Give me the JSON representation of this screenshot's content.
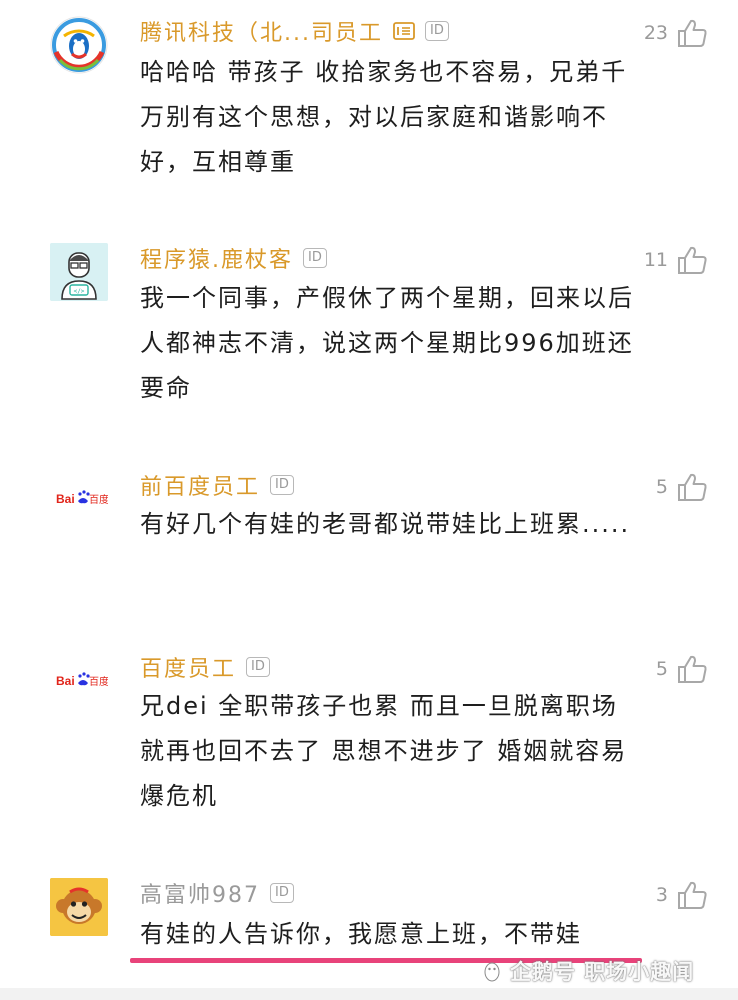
{
  "comments": [
    {
      "username": "腾讯科技（北...司员工",
      "id_badge": "ID",
      "likes": "23",
      "text": "哈哈哈 带孩子 收拾家务也不容易，兄弟千万别有这个思想，对以后家庭和谐影响不好，互相尊重"
    },
    {
      "username": "程序猿.鹿杖客",
      "id_badge": "ID",
      "likes": "11",
      "text": "我一个同事，产假休了两个星期，回来以后人都神志不清，说这两个星期比996加班还要命"
    },
    {
      "username": "前百度员工",
      "id_badge": "ID",
      "likes": "5",
      "text": "有好几个有娃的老哥都说带娃比上班累....."
    },
    {
      "username": "百度员工",
      "id_badge": "ID",
      "likes": "5",
      "text": "兄dei 全职带孩子也累 而且一旦脱离职场就再也回不去了 思想不进步了 婚姻就容易爆危机"
    },
    {
      "username": "高富帅987",
      "id_badge": "ID",
      "likes": "3",
      "text": "有娃的人告诉你，我愿意上班，不带娃"
    }
  ],
  "watermark": {
    "text": "企鹅号 职场小趣闻"
  },
  "colors": {
    "username_accent": "#d9992a",
    "username_gray": "#9a9a9a",
    "underline": "#e8437a"
  },
  "icons": {
    "like": "thumbs-up-icon",
    "avatar_1": "qq-penguin-logo",
    "avatar_2": "coder-avatar",
    "avatar_3": "baidu-logo",
    "avatar_4": "baidu-logo",
    "avatar_5": "monkey-avatar"
  }
}
